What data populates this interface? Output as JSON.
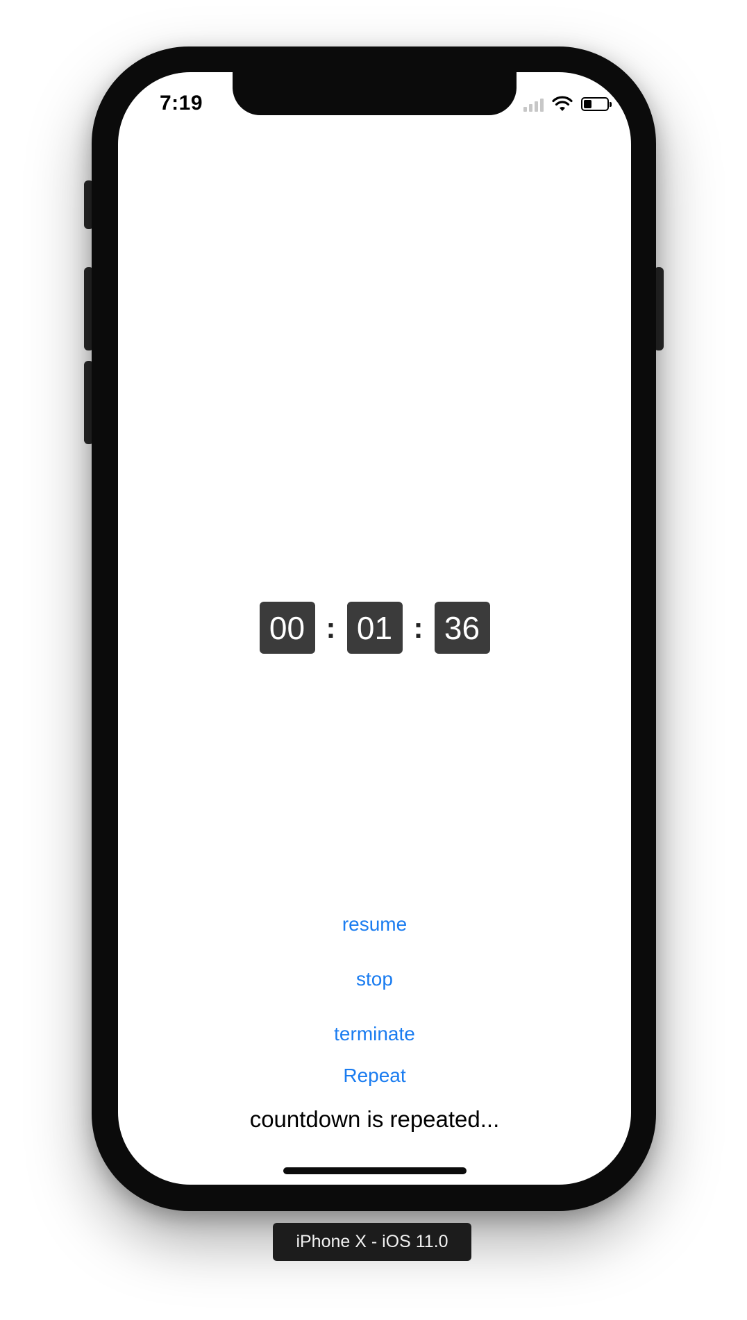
{
  "status_bar": {
    "time": "7:19",
    "icons": [
      "cellular-signal-icon",
      "wifi-icon",
      "battery-icon"
    ],
    "battery_level": 0.35
  },
  "timer": {
    "hours": "00",
    "minutes": "01",
    "seconds": "36",
    "separator": ":"
  },
  "actions": {
    "resume": "resume",
    "stop": "stop",
    "terminate": "terminate",
    "repeat": "Repeat"
  },
  "status_message": "countdown is repeated...",
  "device_label": "iPhone X - iOS 11.0",
  "colors": {
    "accent": "#1a7cf0",
    "digit_box": "#3b3b3b",
    "device_frame": "#0b0b0b"
  }
}
